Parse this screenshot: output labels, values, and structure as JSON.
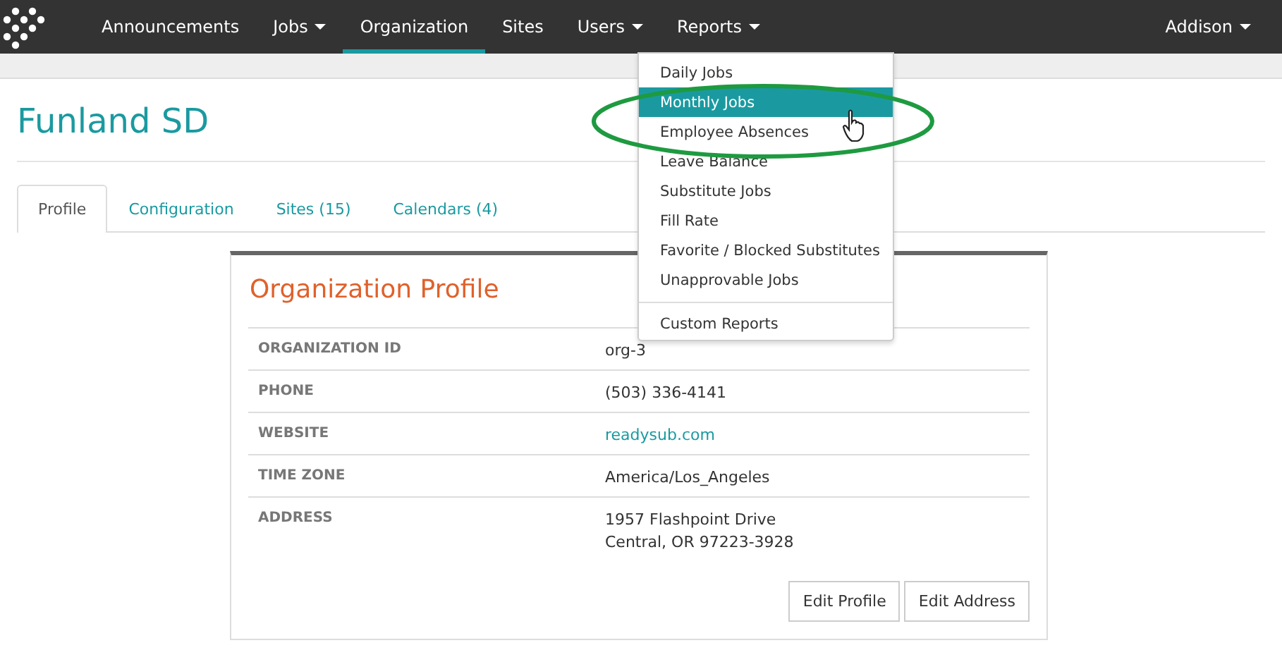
{
  "nav": {
    "items": [
      {
        "label": "Announcements",
        "has_menu": false,
        "selected": false
      },
      {
        "label": "Jobs",
        "has_menu": true,
        "selected": false
      },
      {
        "label": "Organization",
        "has_menu": false,
        "selected": true
      },
      {
        "label": "Sites",
        "has_menu": false,
        "selected": false
      },
      {
        "label": "Users",
        "has_menu": true,
        "selected": false
      },
      {
        "label": "Reports",
        "has_menu": true,
        "selected": false
      }
    ],
    "user": {
      "label": "Addison",
      "has_menu": true
    }
  },
  "page_title": "Funland SD",
  "tabs": [
    {
      "label": "Profile",
      "selected": true
    },
    {
      "label": "Configuration",
      "selected": false
    },
    {
      "label": "Sites (15)",
      "selected": false
    },
    {
      "label": "Calendars (4)",
      "selected": false
    }
  ],
  "card": {
    "title": "Organization Profile",
    "rows": [
      {
        "label": "ORGANIZATION ID",
        "kind": "text",
        "lines": [
          "org-3"
        ]
      },
      {
        "label": "PHONE",
        "kind": "text",
        "lines": [
          "(503) 336-4141"
        ]
      },
      {
        "label": "WEBSITE",
        "kind": "link",
        "lines": [
          "readysub.com"
        ]
      },
      {
        "label": "TIME ZONE",
        "kind": "text",
        "lines": [
          "America/Los_Angeles"
        ]
      },
      {
        "label": "ADDRESS",
        "kind": "text",
        "lines": [
          "1957 Flashpoint Drive",
          "Central, OR 97223-3928"
        ]
      }
    ],
    "buttons": [
      "Edit Profile",
      "Edit Address"
    ]
  },
  "reports_menu": {
    "groups": [
      [
        {
          "label": "Daily Jobs",
          "selected": false
        },
        {
          "label": "Monthly Jobs",
          "selected": true
        },
        {
          "label": "Employee Absences",
          "selected": false
        },
        {
          "label": "Leave Balance",
          "selected": false
        },
        {
          "label": "Substitute Jobs",
          "selected": false
        },
        {
          "label": "Fill Rate",
          "selected": false
        },
        {
          "label": "Favorite / Blocked Substitutes",
          "selected": false
        },
        {
          "label": "Unapprovable Jobs",
          "selected": false
        }
      ],
      [
        {
          "label": "Custom Reports",
          "selected": false
        }
      ]
    ]
  }
}
